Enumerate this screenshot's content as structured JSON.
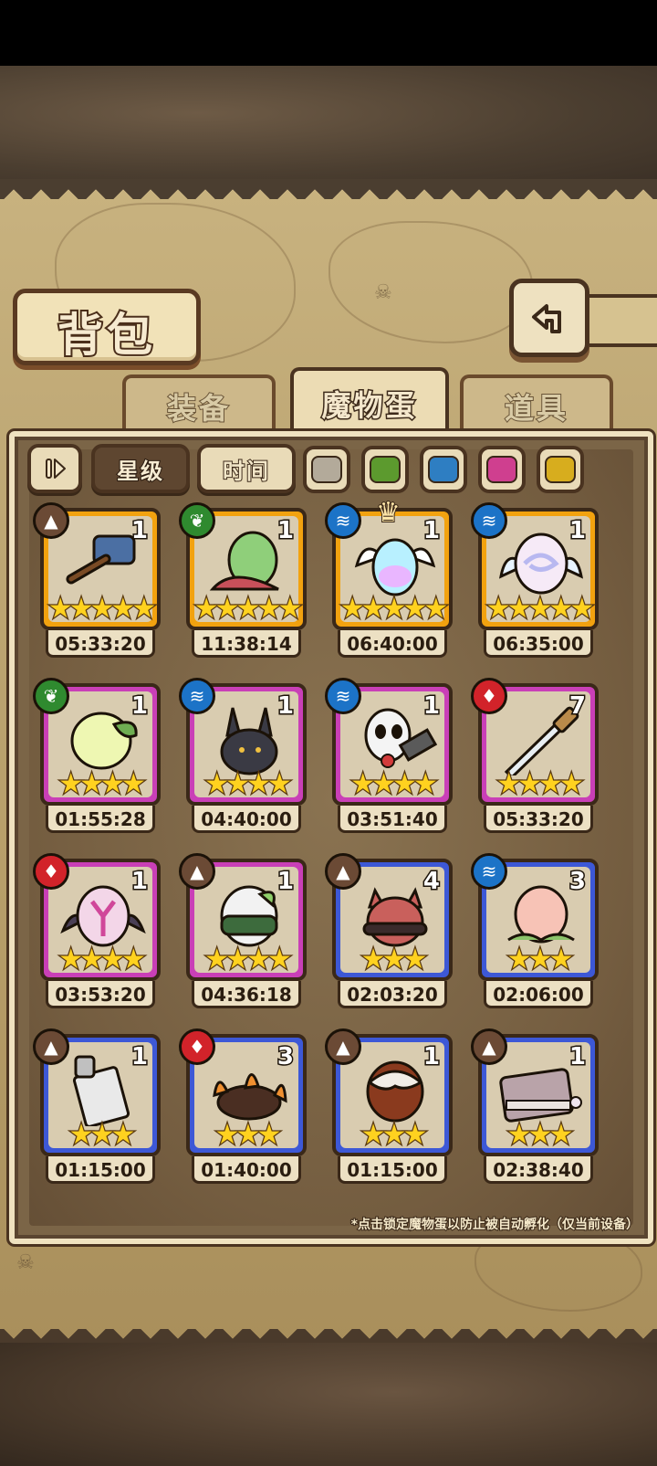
{
  "title": "背包",
  "tabs": [
    {
      "label": "装备",
      "active": false
    },
    {
      "label": "魔物蛋",
      "active": true
    },
    {
      "label": "道具",
      "active": false
    }
  ],
  "controls": {
    "sort_icon": "sort-toggle-icon",
    "star_label": "星级",
    "time_label": "时间",
    "filter_colors": [
      "#b3aa9a",
      "#5c9a2e",
      "#2e7ec2",
      "#cf3f8f",
      "#d7ad1e"
    ]
  },
  "grid": [
    {
      "count": "1",
      "stars": "★★★★★",
      "time": "05:33:20",
      "rarity": "#f2a20f",
      "element": "earth",
      "element_color": "#6b4a35",
      "art": "hammer",
      "crown": false
    },
    {
      "count": "1",
      "stars": "★★★★★",
      "time": "11:38:14",
      "rarity": "#f2a20f",
      "element": "nature",
      "element_color": "#2f8a2f",
      "art": "green-egg",
      "crown": false
    },
    {
      "count": "1",
      "stars": "★★★★★",
      "time": "06:40:00",
      "rarity": "#f2a20f",
      "element": "water",
      "element_color": "#1c73c7",
      "art": "rainbow-winged-egg",
      "crown": true
    },
    {
      "count": "1",
      "stars": "★★★★★",
      "time": "06:35:00",
      "rarity": "#f2a20f",
      "element": "water",
      "element_color": "#1c73c7",
      "art": "swirl-egg",
      "crown": false
    },
    {
      "count": "1",
      "stars": "★★★★",
      "time": "01:55:28",
      "rarity": "#c93fb7",
      "element": "nature",
      "element_color": "#2f8a2f",
      "art": "leaf-egg",
      "crown": false
    },
    {
      "count": "1",
      "stars": "★★★★",
      "time": "04:40:00",
      "rarity": "#c93fb7",
      "element": "water",
      "element_color": "#1c73c7",
      "art": "jackal-egg",
      "crown": false
    },
    {
      "count": "1",
      "stars": "★★★★",
      "time": "03:51:40",
      "rarity": "#c93fb7",
      "element": "water",
      "element_color": "#1c73c7",
      "art": "panda-egg",
      "crown": false
    },
    {
      "count": "7",
      "stars": "★★★★",
      "time": "05:33:20",
      "rarity": "#c93fb7",
      "element": "fire",
      "element_color": "#d2232a",
      "art": "dagger",
      "crown": false
    },
    {
      "count": "1",
      "stars": "★★★★",
      "time": "03:53:20",
      "rarity": "#c93fb7",
      "element": "fire",
      "element_color": "#d2232a",
      "art": "bat-egg",
      "crown": false
    },
    {
      "count": "1",
      "stars": "★★★★",
      "time": "04:36:18",
      "rarity": "#c93fb7",
      "element": "earth",
      "element_color": "#6b4a35",
      "art": "bandit-egg",
      "crown": false
    },
    {
      "count": "4",
      "stars": "★★★",
      "time": "02:03:20",
      "rarity": "#3d58d6",
      "element": "earth",
      "element_color": "#6b4a35",
      "art": "red-cat-egg",
      "crown": false
    },
    {
      "count": "3",
      "stars": "★★★",
      "time": "02:06:00",
      "rarity": "#3d58d6",
      "element": "water",
      "element_color": "#1c73c7",
      "art": "peach-egg",
      "crown": false
    },
    {
      "count": "1",
      "stars": "★★★",
      "time": "01:15:00",
      "rarity": "#3d58d6",
      "element": "earth",
      "element_color": "#6b4a35",
      "art": "cleaver",
      "crown": false
    },
    {
      "count": "3",
      "stars": "★★★",
      "time": "01:40:00",
      "rarity": "#3d58d6",
      "element": "fire",
      "element_color": "#d2232a",
      "art": "fire-claw",
      "crown": false
    },
    {
      "count": "1",
      "stars": "★★★",
      "time": "01:15:00",
      "rarity": "#3d58d6",
      "element": "earth",
      "element_color": "#6b4a35",
      "art": "choco-egg",
      "crown": false
    },
    {
      "count": "1",
      "stars": "★★★",
      "time": "02:38:40",
      "rarity": "#3d58d6",
      "element": "earth",
      "element_color": "#6b4a35",
      "art": "book",
      "crown": false
    }
  ],
  "note": "*点击锁定魔物蛋以防止被自动孵化（仅当前设备）"
}
